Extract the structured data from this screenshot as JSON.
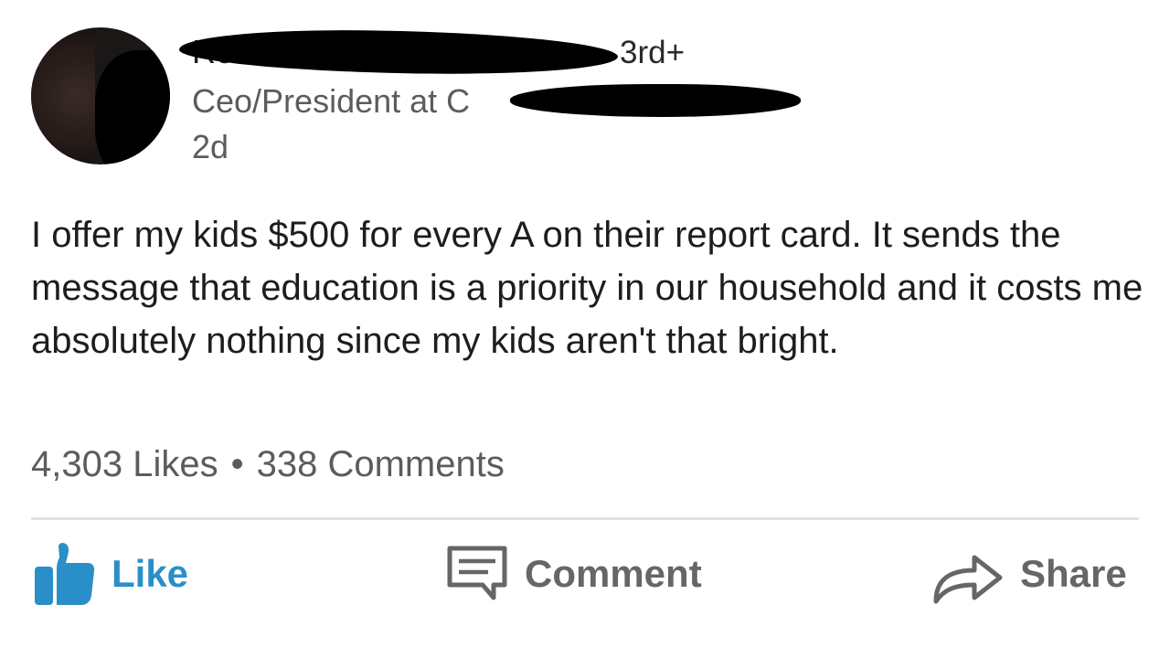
{
  "author": {
    "name": "Ro",
    "degree": "3rd+",
    "headline": "Ceo/President at C",
    "time_ago": "2d"
  },
  "post": {
    "text": "I offer my kids $500 for every A on their report card. It sends the message that education is a priority in our household and it costs me absolutely nothing since my kids aren't that bright."
  },
  "stats": {
    "likes": "4,303 Likes",
    "separator": "•",
    "comments": "338 Comments"
  },
  "actions": {
    "like_label": "Like",
    "comment_label": "Comment",
    "share_label": "Share"
  },
  "colors": {
    "accent": "#2a8fc9",
    "muted_text": "#5c5c5c",
    "action_gray": "#666666",
    "redaction": "#000000"
  },
  "icons": {
    "like": "thumbs-up-icon",
    "comment": "comment-icon",
    "share": "share-arrow-icon"
  }
}
